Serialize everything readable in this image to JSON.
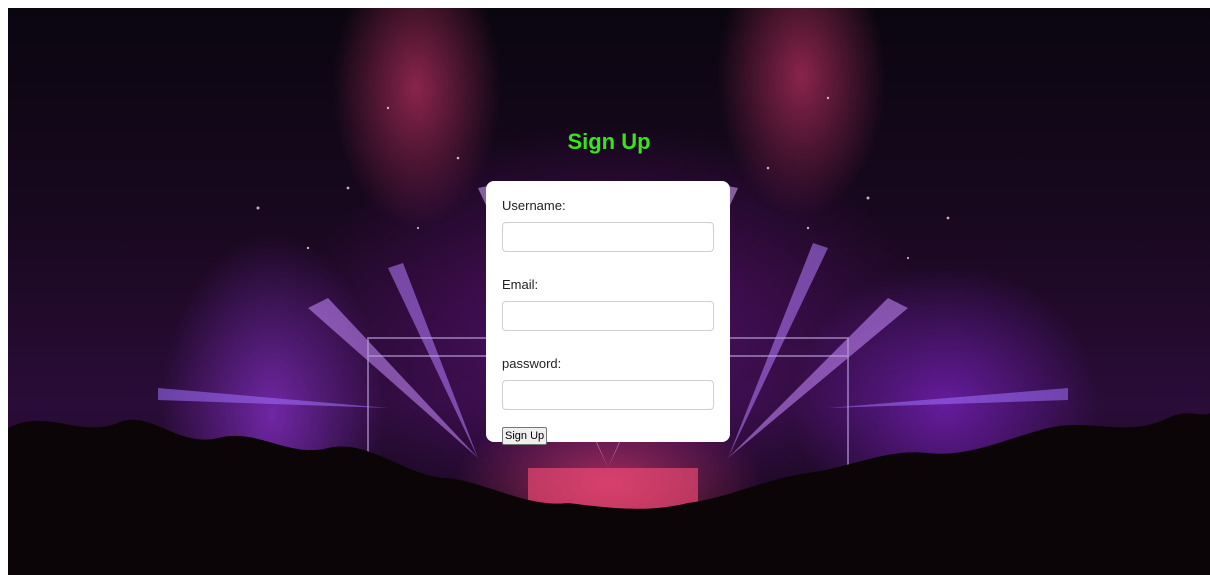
{
  "page": {
    "title": "Sign Up"
  },
  "form": {
    "fields": [
      {
        "label": "Username:",
        "value": "",
        "placeholder": ""
      },
      {
        "label": "Email:",
        "value": "",
        "placeholder": ""
      },
      {
        "label": "password:",
        "value": "",
        "placeholder": ""
      }
    ],
    "submit_label": "Sign Up"
  },
  "colors": {
    "title": "#39e51a",
    "card": "#ffffff"
  },
  "background": {
    "description_icon": "concert-crowd-image"
  }
}
